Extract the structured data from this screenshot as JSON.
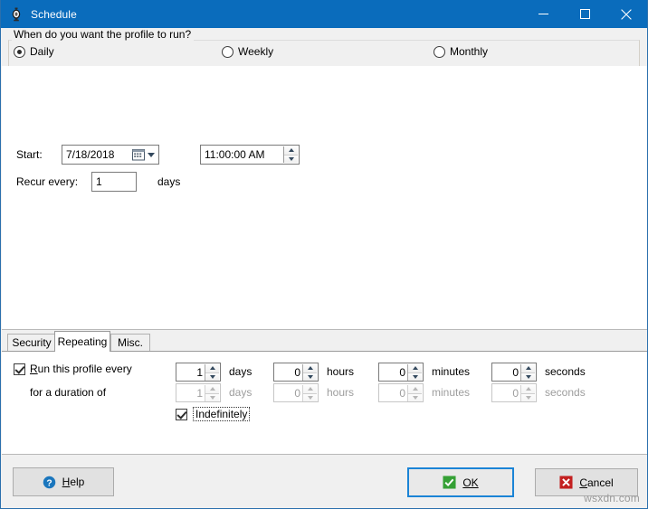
{
  "window": {
    "title": "Schedule",
    "icon": "schedule-clock-icon",
    "accent_color": "#0a6cbc",
    "caption": {
      "minimize": "minimize-icon",
      "maximize": "maximize-icon",
      "close": "close-icon"
    }
  },
  "schedule_group": {
    "legend": "When do you want the profile to run?",
    "options": [
      {
        "label": "Daily",
        "selected": true
      },
      {
        "label": "Weekly",
        "selected": false
      },
      {
        "label": "Monthly",
        "selected": false
      }
    ]
  },
  "start": {
    "label": "Start:",
    "date_value": "7/18/2018",
    "date_icon": "calendar-icon",
    "dropdown_icon": "chevron-down-icon",
    "time_value": "11:00:00 AM"
  },
  "recur": {
    "label": "Recur every:",
    "value": "1",
    "unit": "days"
  },
  "tabs": [
    {
      "label": "Security",
      "active": false
    },
    {
      "label": "Repeating",
      "active": true
    },
    {
      "label": "Misc.",
      "active": false
    }
  ],
  "repeating": {
    "run_every": {
      "checkbox_label_prefix": "R",
      "checkbox_label_rest": "un this profile every",
      "checked": true,
      "days": "1",
      "hours": "0",
      "minutes": "0",
      "seconds": "0"
    },
    "duration": {
      "label": "for a duration of",
      "days": "1",
      "hours": "0",
      "minutes": "0",
      "seconds": "0",
      "enabled": false
    },
    "indefinitely": {
      "label": "Indefinitely",
      "checked": true,
      "focused": true
    },
    "units": {
      "days": "days",
      "hours": "hours",
      "minutes": "minutes",
      "seconds": "seconds"
    }
  },
  "buttons": {
    "help": {
      "label": "Help",
      "mnemonic": "H",
      "icon": "help-question-icon"
    },
    "ok": {
      "label": "OK",
      "mnemonic": "O",
      "icon": "green-check-icon",
      "default": true
    },
    "cancel": {
      "label": "Cancel",
      "mnemonic": "C",
      "icon": "red-x-icon"
    }
  },
  "watermark": "wsxdn.com"
}
